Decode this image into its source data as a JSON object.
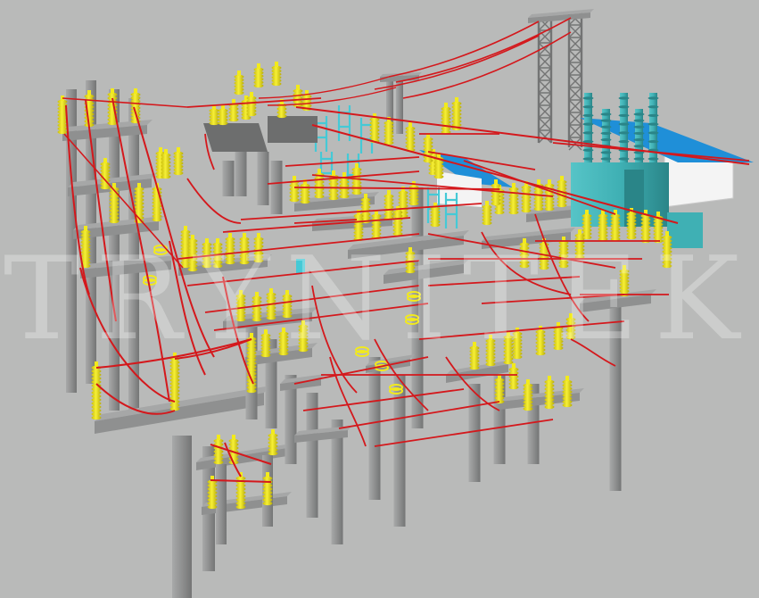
{
  "watermark": {
    "text": "TRYNITEK"
  },
  "colors": {
    "background": "#b9bab9",
    "structure": "#8f9090",
    "structure_light": "#a6a7a7",
    "structure_dark": "#737474",
    "insulator": "#f2ea1c",
    "insulator_shade": "#c9bd0a",
    "conductor": "#d4181c",
    "transformer": "#3fb0b4",
    "transformer_dark": "#2a8588",
    "roof": "#1f8fd8",
    "building_wall": "#f4f4f4",
    "railing": "#45c9d6"
  },
  "icons": [
    "substation-3d-model"
  ]
}
